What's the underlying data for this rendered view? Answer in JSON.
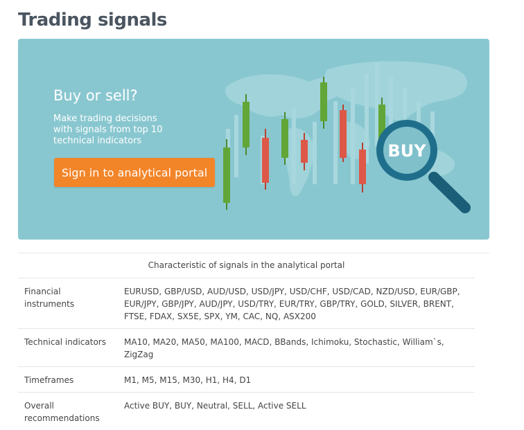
{
  "page": {
    "title": "Trading signals"
  },
  "banner": {
    "heading": "Buy or sell?",
    "description": "Make trading decisions with signals from top 10 technical indicators",
    "cta_label": "Sign in to analytical portal",
    "magnifier_text": "BUY",
    "colors": {
      "background": "#89c7d0",
      "button": "#f38529",
      "candle_green": "#62a637",
      "candle_red": "#de5848",
      "magnifier": "#1f6f8c"
    }
  },
  "table": {
    "caption": "Characteristic of signals in the analytical portal",
    "rows": [
      {
        "label": "Financial instruments",
        "value": "EURUSD, GBP/USD, AUD/USD, USD/JPY, USD/CHF, USD/CAD, NZD/USD, EUR/GBP, EUR/JPY, GBP/JPY, AUD/JPY, USD/TRY, EUR/TRY, GBP/TRY, GOLD, SILVER, BRENT, FTSE, FDAX, SX5E, SPX, YM, CAC, NQ, ASX200"
      },
      {
        "label": "Technical indicators",
        "value": "MA10, MA20, MA50, MA100, MACD, BBands, Ichimoku, Stochastic, William`s, ZigZag"
      },
      {
        "label": "Timeframes",
        "value": "M1, M5, M15, M30, H1, H4, D1"
      },
      {
        "label": "Overall recommendations",
        "value": "Active BUY, BUY, Neutral, SELL, Active SELL"
      }
    ]
  }
}
